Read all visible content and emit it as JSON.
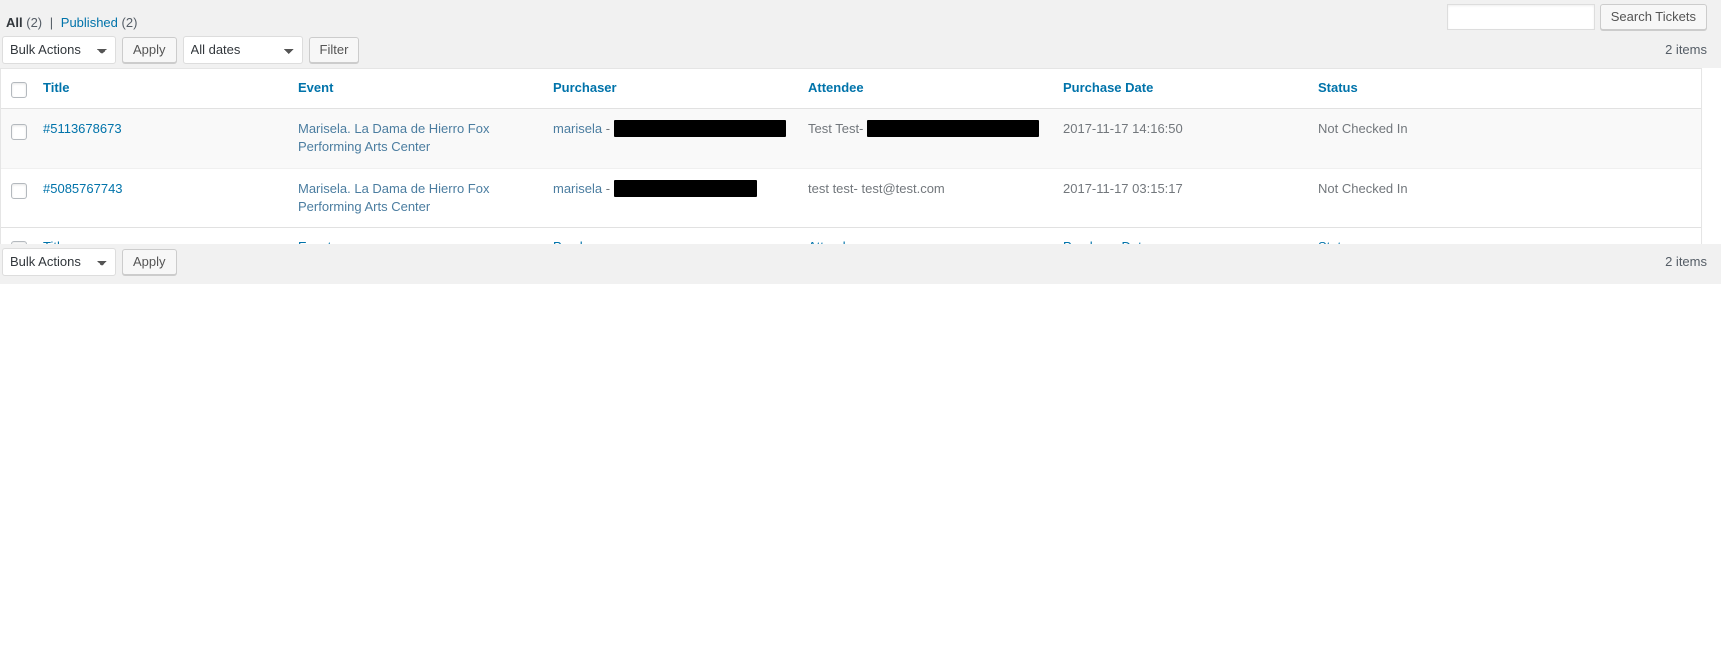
{
  "views": {
    "all_label": "All",
    "all_count": "(2)",
    "separator": "|",
    "published_label": "Published",
    "published_count": "(2)"
  },
  "search": {
    "value": "",
    "placeholder": "",
    "button_label": "Search Tickets"
  },
  "tablenav_top": {
    "bulk_selected": "Bulk Actions",
    "bulk_options": [
      "Bulk Actions"
    ],
    "apply_label": "Apply",
    "dates_selected": "All dates",
    "dates_options": [
      "All dates"
    ],
    "filter_label": "Filter",
    "displaying_num": "2 items"
  },
  "tablenav_bottom": {
    "bulk_selected": "Bulk Actions",
    "bulk_options": [
      "Bulk Actions"
    ],
    "apply_label": "Apply",
    "displaying_num": "2 items"
  },
  "table": {
    "columns": [
      {
        "key": "cb",
        "label": ""
      },
      {
        "key": "title",
        "label": "Title"
      },
      {
        "key": "event",
        "label": "Event"
      },
      {
        "key": "purchaser",
        "label": "Purchaser"
      },
      {
        "key": "attendee",
        "label": "Attendee"
      },
      {
        "key": "purchase_date",
        "label": "Purchase Date"
      },
      {
        "key": "status",
        "label": "Status"
      }
    ],
    "rows": [
      {
        "title": "#5113678673",
        "event": "Marisela. La Dama de Hierro Fox Performing Arts Center",
        "purchaser_name": "marisela",
        "purchaser_sep": "-",
        "purchaser_email": "[redacted]",
        "attendee_name": "Test Test-",
        "attendee_email": "[redacted]",
        "purchase_date": "2017-11-17 14:16:50",
        "status": "Not Checked In"
      },
      {
        "title": "#5085767743",
        "event": "Marisela. La Dama de Hierro Fox Performing Arts Center",
        "purchaser_name": "marisela",
        "purchaser_sep": "-",
        "purchaser_email": "[redacted]",
        "attendee_name": "test test-",
        "attendee_email": "test@test.com",
        "purchase_date": "2017-11-17 03:15:17",
        "status": "Not Checked In"
      }
    ]
  },
  "colors": {
    "link": "#0073aa",
    "muted_link": "#4b7da0",
    "text": "#555d66",
    "band": "#f1f1f1",
    "redaction": "#000000"
  }
}
